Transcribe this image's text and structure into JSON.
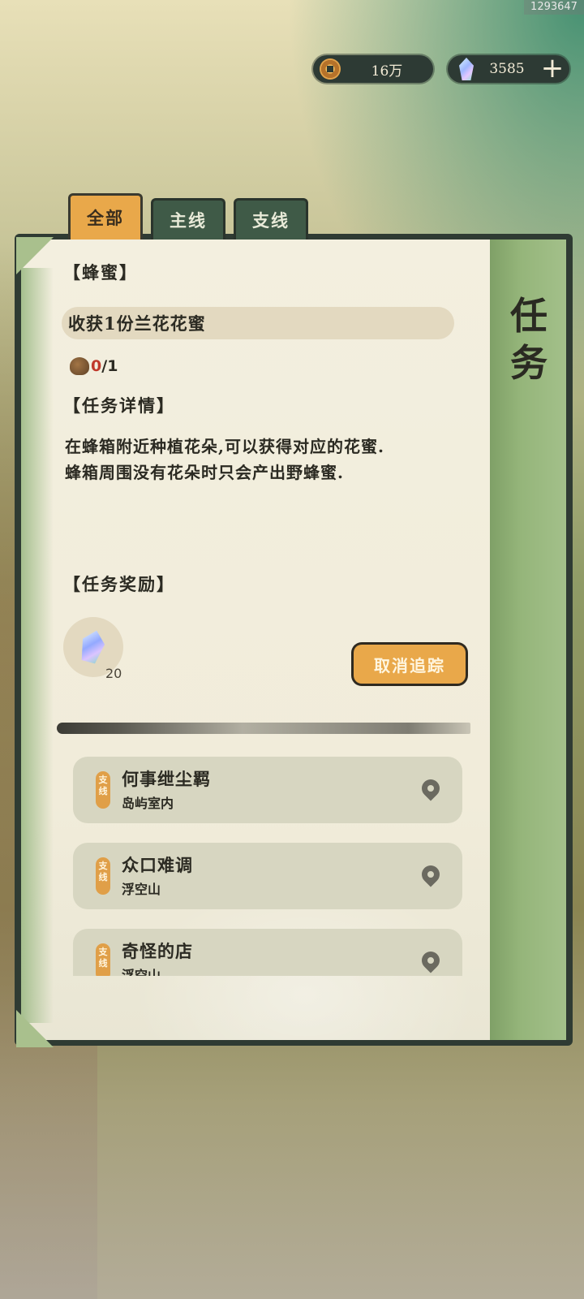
{
  "build_id": "1293647",
  "currency": {
    "coins": "16万",
    "gems": "3585"
  },
  "tabs": [
    {
      "label": "全部",
      "active": true
    },
    {
      "label": "主线",
      "active": false
    },
    {
      "label": "支线",
      "active": false
    }
  ],
  "panel_title": [
    "任",
    "务"
  ],
  "current_quest": {
    "name": "【蜂蜜】",
    "objective": "收获1份兰花花蜜",
    "progress": {
      "current": "0",
      "separator": "/",
      "total": "1"
    },
    "details_heading": "【任务详情】",
    "details": [
      "在蜂箱附近种植花朵,可以获得对应的花蜜.",
      "蜂箱周围没有花朵时只会产出野蜂蜜."
    ],
    "reward_heading": "【任务奖励】",
    "reward": {
      "icon": "gem-icon",
      "count": "20"
    },
    "cancel_button": "取消追踪"
  },
  "quest_list": [
    {
      "tag": "支线",
      "name": "何事绁尘羁",
      "location": "岛屿室内"
    },
    {
      "tag": "支线",
      "name": "众口难调",
      "location": "浮空山"
    },
    {
      "tag": "支线",
      "name": "奇怪的店",
      "location": "浮空山"
    }
  ],
  "colors": {
    "accent_orange": "#e9a84a",
    "tab_green": "#3f5a47",
    "paper": "#f3efdf",
    "progress_red": "#c0392b"
  }
}
